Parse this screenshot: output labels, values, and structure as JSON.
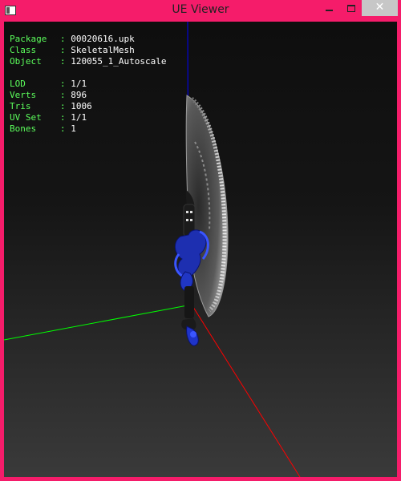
{
  "window": {
    "title": "UE Viewer",
    "close_glyph": "✕"
  },
  "icons": {
    "app": "app-icon",
    "minimize": "minimize-icon",
    "maximize": "maximize-icon",
    "close": "close-icon"
  },
  "info": {
    "package": {
      "label": "Package",
      "value": "00020616.upk"
    },
    "class": {
      "label": "Class",
      "value": "SkeletalMesh"
    },
    "object": {
      "label": "Object",
      "value": "120055_1_Autoscale"
    },
    "lod": {
      "label": "LOD",
      "value": "1/1"
    },
    "verts": {
      "label": "Verts",
      "value": "896"
    },
    "tris": {
      "label": "Tris",
      "value": "1006"
    },
    "uvset": {
      "label": "UV Set",
      "value": "1/1"
    },
    "bones": {
      "label": "Bones",
      "value": "1"
    }
  },
  "colors": {
    "frame": "#f51c6a",
    "label": "#5cff5c",
    "value": "#ffffff",
    "axis_x": "#ff0000",
    "axis_y": "#00ff00",
    "axis_z": "#0000ff"
  }
}
